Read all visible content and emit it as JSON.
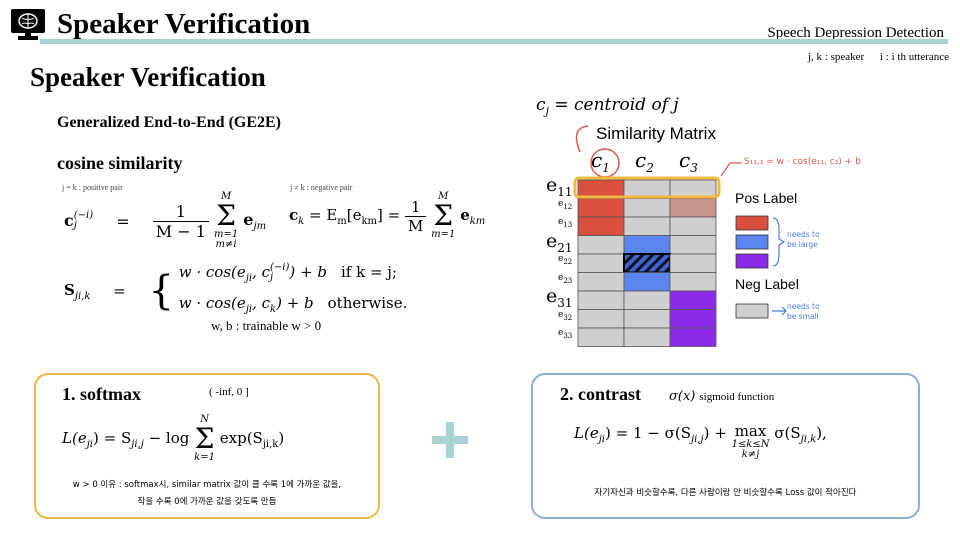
{
  "header": {
    "title": "Speaker Verification",
    "subtitle": "Speech Depression Detection",
    "legend_jk": "j, k : speaker",
    "legend_i": "i : i th utterance",
    "accent_color": "#a9d3d3"
  },
  "slide": {
    "title": "Speaker Verification",
    "method": "Generalized End-to-End (GE2E)",
    "cosine_heading": "cosine similarity",
    "positive_pair_note": "j = k : positive pair",
    "negative_pair_note": "j ≠ k : negative pair",
    "trainable_note": "w, b : trainable    w > 0"
  },
  "equations": {
    "centroid_excl_lhs_base": "c",
    "centroid_excl_lhs_sub": "j",
    "centroid_excl_lhs_sup": "(−i)",
    "equals": "=",
    "frac_one": "1",
    "frac_den_excl": "M − 1",
    "sum_top": "M",
    "sum_bottom_excl_1": "m=1",
    "sum_bottom_excl_2": "m≠i",
    "sum_bottom": "m=1",
    "sum_symbol": "Σ",
    "term_ejm": "e",
    "term_ejm_sub": "jm",
    "centroid_lhs_base": "c",
    "centroid_lhs_sub": "k",
    "expectation": "= E",
    "expectation_sub": "m",
    "expectation_arg": "[e",
    "expectation_arg_sub": "km",
    "expectation_close": "] =",
    "frac_den": "M",
    "term_ekm": "e",
    "term_ekm_sub": "km",
    "sim_lhs_base": "S",
    "sim_lhs_sub": "ji,k",
    "case1_expr": "w · cos(e",
    "case1_sub": "ji",
    "case1_mid": ", c",
    "case1_mid_sub": "j",
    "case1_mid_sup": "(−i)",
    "case1_end": ") + b",
    "case1_cond": "if    k = j;",
    "case2_expr": "w · cos(e",
    "case2_sub": "ji",
    "case2_mid": ", c",
    "case2_mid_sub": "k",
    "case2_end": ") + b",
    "case2_cond": "otherwise."
  },
  "softmax": {
    "title": "1. softmax",
    "range": "( -inf, 0 ]",
    "loss_lhs": "L(e",
    "loss_lhs_sub": "ji",
    "loss_eq": ") = S",
    "loss_S_sub": "ji,j",
    "loss_log": " − log",
    "sum_top": "N",
    "sum_bottom": "k=1",
    "loss_exp": "exp(S",
    "loss_exp_sub": "ji,k",
    "loss_close": ")",
    "note_line1": "w > 0 이유 : softmax시, similar matrix 값이 클 수록 1에 가까운 값을,",
    "note_line2": "작을 수록 0에 가까운 값을  갖도록 만듬",
    "border_color": "#f0b73f"
  },
  "contrast": {
    "title": "2. contrast",
    "sigma_label": "σ(x)",
    "sigmoid_note": "sigmoid function",
    "loss_lhs": "L(e",
    "loss_lhs_sub": "ji",
    "loss_eq": ") = 1 − σ(S",
    "loss_S_sub": "ji,j",
    "loss_plus": ") + ",
    "max_op": "max",
    "max_sub1": "1≤k≤N",
    "max_sub2": "k≠j",
    "loss_sig": "σ(S",
    "loss_sig_sub": "ji,k",
    "loss_close": "),",
    "note": "자기자신과 비슷할수록, 다른 사람이랑 안 비슷할수록 Loss 값이 작아진다",
    "border_color": "#8eaed8"
  },
  "similarity": {
    "centroid_def_lhs": "c",
    "centroid_def_sub": "j",
    "centroid_def_rhs": "= centroid of j",
    "matrix_title": "Similarity Matrix",
    "col_labels": [
      "c",
      "c",
      "c"
    ],
    "col_subs": [
      "1",
      "2",
      "3"
    ],
    "row_labels": [
      {
        "base": "e",
        "sub": "11"
      },
      {
        "base": "e",
        "sub": "12"
      },
      {
        "base": "e",
        "sub": "13"
      },
      {
        "base": "e",
        "sub": "21"
      },
      {
        "base": "e",
        "sub": "22"
      },
      {
        "base": "e",
        "sub": "23"
      },
      {
        "base": "e",
        "sub": "31"
      },
      {
        "base": "e",
        "sub": "32"
      },
      {
        "base": "e",
        "sub": "33"
      }
    ],
    "annotation": "S₁₁,₃ = w · cos(e₁₁, c₃) + b",
    "pos_label": "Pos Label",
    "neg_label": "Neg Label",
    "pos_note_1": "needs to",
    "pos_note_2": "be large",
    "neg_note_1": "needs to",
    "neg_note_2": "be small",
    "colors": {
      "red": "#d9503f",
      "blue": "#5a85ee",
      "purple": "#8a2be8",
      "gray": "#cfcfcf",
      "pink": "#c9948f",
      "highlight": "#f2b940",
      "hatch": "#3a64d8"
    }
  }
}
